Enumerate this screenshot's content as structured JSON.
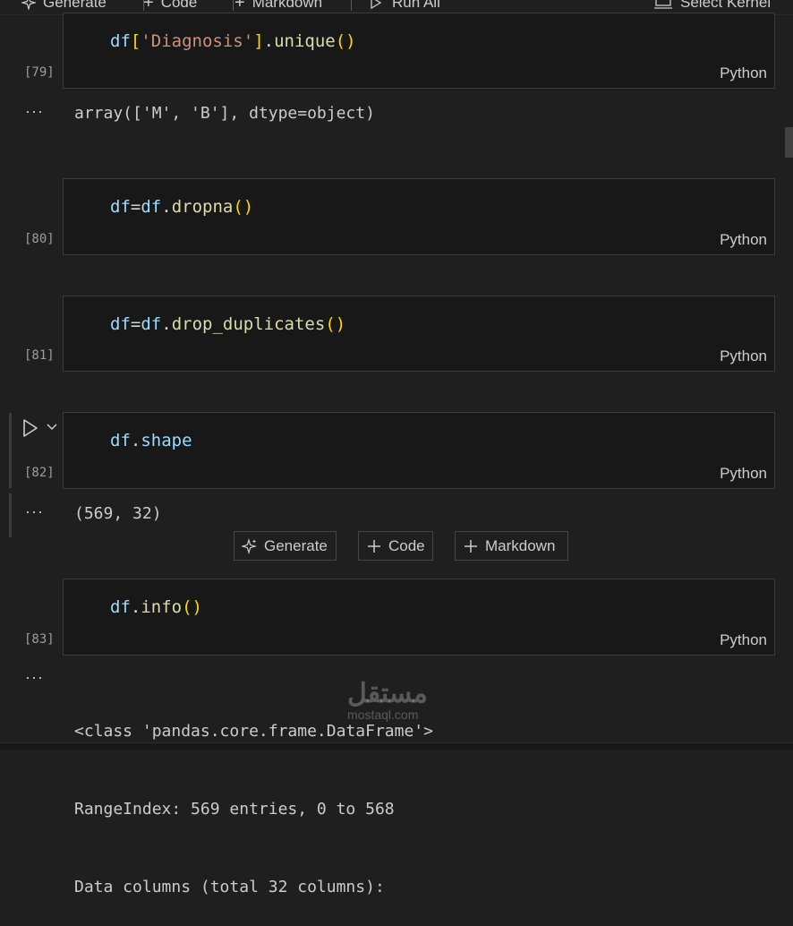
{
  "toolbar": {
    "generate_label": "Generate",
    "code_label": "Code",
    "markdown_label": "Markdown",
    "run_all_label": "Run All",
    "select_kernel_label": "Select Kernel"
  },
  "cells": [
    {
      "exec_count": "[79]",
      "lang": "Python",
      "output": "array(['M', 'B'], dtype=object)"
    },
    {
      "exec_count": "[80]",
      "lang": "Python"
    },
    {
      "exec_count": "[81]",
      "lang": "Python"
    },
    {
      "exec_count": "[82]",
      "lang": "Python",
      "output": "(569, 32)"
    },
    {
      "exec_count": "[83]",
      "lang": "Python",
      "output_lines": [
        "<class 'pandas.core.frame.DataFrame'>",
        "RangeIndex: 569 entries, 0 to 568",
        "Data columns (total 32 columns):"
      ]
    }
  ],
  "code": {
    "c79": {
      "var": "df",
      "open": "[",
      "str": "'Diagnosis'",
      "close": "]",
      "dot": ".",
      "fn": "unique",
      "paren": "()"
    },
    "c80": {
      "var1": "df",
      "eq": "=",
      "var2": "df",
      "dot": ".",
      "fn": "dropna",
      "paren": "()"
    },
    "c81": {
      "var1": "df",
      "eq": "=",
      "var2": "df",
      "dot": ".",
      "fn": "drop_duplicates",
      "paren": "()"
    },
    "c82": {
      "var": "df",
      "dot": ".",
      "attr": "shape"
    },
    "c83": {
      "var": "df",
      "dot": ".",
      "fn": "info",
      "paren": "()"
    }
  },
  "output_more_symbol": "···",
  "insert_buttons": {
    "generate_label": "Generate",
    "code_label": "Code",
    "markdown_label": "Markdown"
  },
  "watermark": {
    "main": "مستقل",
    "sub": "mostaql.com"
  },
  "icons": [
    "sparkle-icon",
    "plus-icon",
    "run-icon",
    "chevron-down-icon",
    "kernel-icon"
  ]
}
